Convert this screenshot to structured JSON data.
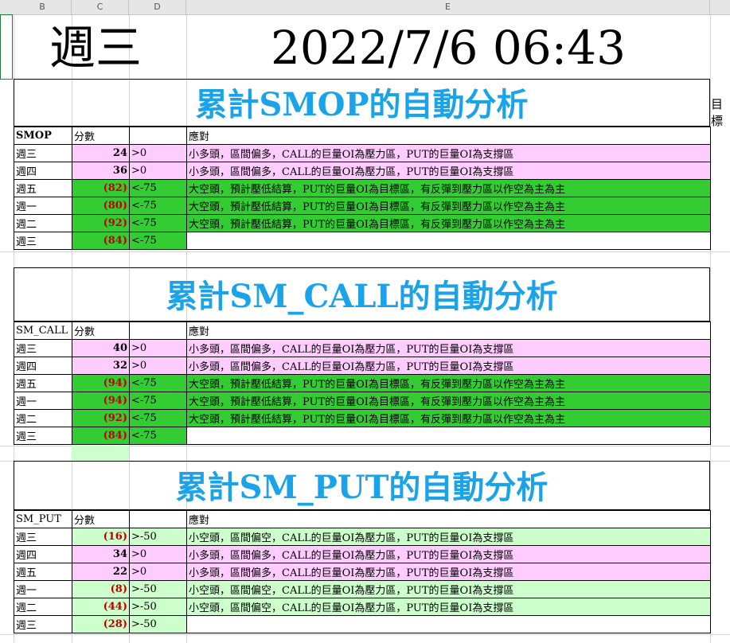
{
  "columns": [
    "B",
    "C",
    "D",
    "E"
  ],
  "header": {
    "day": "週三",
    "datetime": "2022/7/6 06:43"
  },
  "side_text": "目標",
  "sections": [
    {
      "title": "累計SMOP的自動分析",
      "col_label": "SMOP",
      "score_label": "分數",
      "response_label": "應對",
      "rows": [
        {
          "day": "週三",
          "score": "24",
          "neg": false,
          "cond": ">0",
          "text": "小多頭，區間偏多，CALL的巨量OI為壓力區，PUT的巨量OI為支撐區",
          "color": "pink"
        },
        {
          "day": "週四",
          "score": "36",
          "neg": false,
          "cond": ">0",
          "text": "小多頭，區間偏多，CALL的巨量OI為壓力區，PUT的巨量OI為支撐區",
          "color": "pink"
        },
        {
          "day": "週五",
          "score": "(82)",
          "neg": true,
          "cond": "<-75",
          "text": "大空頭，預計壓低結算，PUT的巨量OI為目標區，有反彈到壓力區以作空為主為主",
          "color": "green"
        },
        {
          "day": "週一",
          "score": "(80)",
          "neg": true,
          "cond": "<-75",
          "text": "大空頭，預計壓低結算，PUT的巨量OI為目標區，有反彈到壓力區以作空為主為主",
          "color": "green"
        },
        {
          "day": "週二",
          "score": "(92)",
          "neg": true,
          "cond": "<-75",
          "text": "大空頭，預計壓低結算，PUT的巨量OI為目標區，有反彈到壓力區以作空為主為主",
          "color": "green"
        },
        {
          "day": "週三",
          "score": "(84)",
          "neg": true,
          "cond": "<-75",
          "text": "",
          "color": "green"
        }
      ]
    },
    {
      "title": "累計SM_CALL的自動分析",
      "col_label": "SM_CALL",
      "score_label": "分數",
      "response_label": "應對",
      "rows": [
        {
          "day": "週三",
          "score": "40",
          "neg": false,
          "cond": ">0",
          "text": "小多頭，區間偏多，CALL的巨量OI為壓力區，PUT的巨量OI為支撐區",
          "color": "pink"
        },
        {
          "day": "週四",
          "score": "32",
          "neg": false,
          "cond": ">0",
          "text": "小多頭，區間偏多，CALL的巨量OI為壓力區，PUT的巨量OI為支撐區",
          "color": "pink"
        },
        {
          "day": "週五",
          "score": "(94)",
          "neg": true,
          "cond": "<-75",
          "text": "大空頭，預計壓低結算，PUT的巨量OI為目標區，有反彈到壓力區以作空為主為主",
          "color": "green"
        },
        {
          "day": "週一",
          "score": "(94)",
          "neg": true,
          "cond": "<-75",
          "text": "大空頭，預計壓低結算，PUT的巨量OI為目標區，有反彈到壓力區以作空為主為主",
          "color": "green"
        },
        {
          "day": "週二",
          "score": "(92)",
          "neg": true,
          "cond": "<-75",
          "text": "大空頭，預計壓低結算，PUT的巨量OI為目標區，有反彈到壓力區以作空為主為主",
          "color": "green"
        },
        {
          "day": "週三",
          "score": "(84)",
          "neg": true,
          "cond": "<-75",
          "text": "",
          "color": "green"
        }
      ]
    },
    {
      "title": "累計SM_PUT的自動分析",
      "col_label": "SM_PUT",
      "score_label": "分數",
      "response_label": "應對",
      "rows": [
        {
          "day": "週三",
          "score": "(16)",
          "neg": true,
          "cond": ">-50",
          "text": "小空頭，區間偏空，CALL的巨量OI為壓力區，PUT的巨量OI為支撐區",
          "color": "lgreen"
        },
        {
          "day": "週四",
          "score": "34",
          "neg": false,
          "cond": ">0",
          "text": "小多頭，區間偏多，CALL的巨量OI為壓力區，PUT的巨量OI為支撐區",
          "color": "pink"
        },
        {
          "day": "週五",
          "score": "22",
          "neg": false,
          "cond": ">0",
          "text": "小多頭，區間偏多，CALL的巨量OI為壓力區，PUT的巨量OI為支撐區",
          "color": "pink"
        },
        {
          "day": "週一",
          "score": "(8)",
          "neg": true,
          "cond": ">-50",
          "text": "小空頭，區間偏空，CALL的巨量OI為壓力區，PUT的巨量OI為支撐區",
          "color": "lgreen"
        },
        {
          "day": "週二",
          "score": "(44)",
          "neg": true,
          "cond": ">-50",
          "text": "小空頭，區間偏空，CALL的巨量OI為壓力區，PUT的巨量OI為支撐區",
          "color": "lgreen"
        },
        {
          "day": "週三",
          "score": "(28)",
          "neg": true,
          "cond": ">-50",
          "text": "",
          "color": "lgreen"
        }
      ]
    }
  ]
}
